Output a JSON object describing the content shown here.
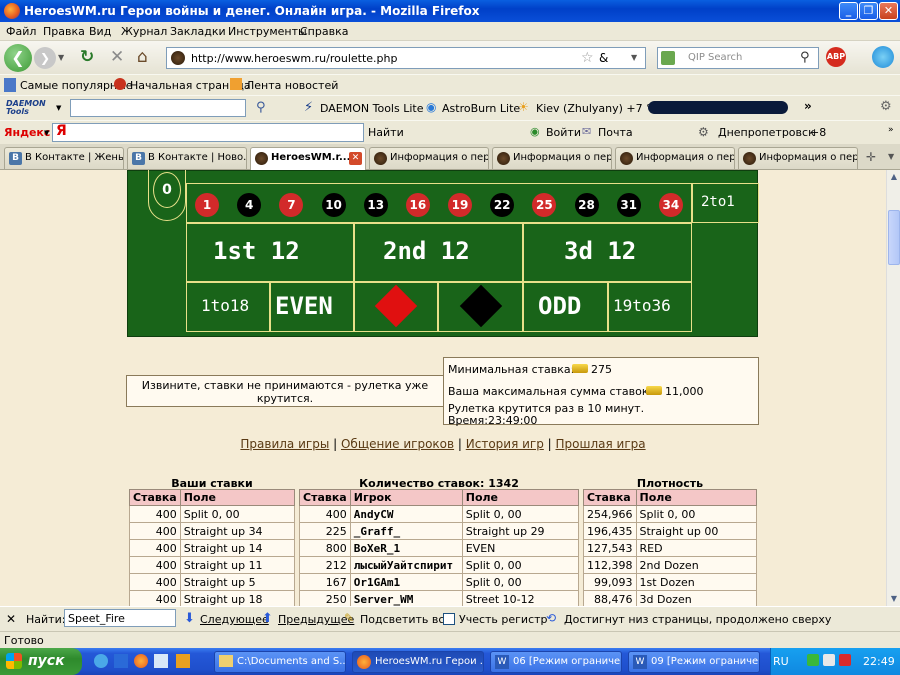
{
  "window": {
    "title": "HeroesWM.ru Герои войны и денег. Онлайн игра. - Mozilla Firefox"
  },
  "menu": [
    "Файл",
    "Правка",
    "Вид",
    "Журнал",
    "Закладки",
    "Инструменты",
    "Справка"
  ],
  "nav": {
    "url": "http://www.heroeswm.ru/roulette.php",
    "search_placeholder": "QIP Search"
  },
  "bookmarks": [
    "Самые популярные",
    "Начальная страница",
    "Лента новостей"
  ],
  "daemon_toolbar": {
    "logo": "DAEMON Tools",
    "items": [
      "DAEMON Tools Lite",
      "AstroBurn Lite",
      "Kiev (Zhulyany) +7 °C"
    ]
  },
  "yandex_toolbar": {
    "logo": "Яндекс",
    "items": [
      "Найти",
      "Войти",
      "Почта",
      "Днепропетровск",
      "+8"
    ]
  },
  "tabs": [
    {
      "label": "В Контакте | Жень..."
    },
    {
      "label": "В Контакте | Ново..."
    },
    {
      "label": "HeroesWM.r..."
    },
    {
      "label": "Информация о пер..."
    },
    {
      "label": "Информация о пер..."
    },
    {
      "label": "Информация о пер..."
    },
    {
      "label": "Информация о пер..."
    }
  ],
  "roulette": {
    "zero": "0",
    "numbers": [
      {
        "n": "1",
        "c": "red"
      },
      {
        "n": "4",
        "c": "black"
      },
      {
        "n": "7",
        "c": "red"
      },
      {
        "n": "10",
        "c": "black"
      },
      {
        "n": "13",
        "c": "black"
      },
      {
        "n": "16",
        "c": "red"
      },
      {
        "n": "19",
        "c": "red"
      },
      {
        "n": "22",
        "c": "black"
      },
      {
        "n": "25",
        "c": "red"
      },
      {
        "n": "28",
        "c": "black"
      },
      {
        "n": "31",
        "c": "black"
      },
      {
        "n": "34",
        "c": "red"
      }
    ],
    "column_bet": "2to1",
    "dozens": [
      "1st 12",
      "2nd 12",
      "3d 12"
    ],
    "outside": [
      "1to18",
      "EVEN",
      "ODD",
      "19to36"
    ]
  },
  "notice": "Извините, ставки не принимаются - рулетка уже крутится.",
  "info": {
    "min_bet_label": "Минимальная ставка:",
    "min_bet": "275",
    "max_bet_label": "Ваша максимальная сумма ставок:",
    "max_bet": "11,000",
    "spin_text": "Рулетка крутится раз в 10 минут.",
    "time_label": "Время:",
    "time": "23:49:00"
  },
  "links": [
    "Правила игры",
    "Общение игроков",
    "История игр",
    "Прошлая игра"
  ],
  "your_bets": {
    "title": "Ваши ставки",
    "headers": [
      "Ставка",
      "Поле"
    ],
    "rows": [
      [
        "400",
        "Split 0, 00"
      ],
      [
        "400",
        "Straight up 34"
      ],
      [
        "400",
        "Straight up 14"
      ],
      [
        "400",
        "Straight up 11"
      ],
      [
        "400",
        "Straight up 5"
      ],
      [
        "400",
        "Straight up 18"
      ]
    ]
  },
  "all_bets": {
    "title": "Количество ставок: 1342",
    "headers": [
      "Ставка",
      "Игрок",
      "Поле"
    ],
    "rows": [
      [
        "400",
        "AndyCW",
        "Split 0, 00"
      ],
      [
        "225",
        "_Graff_",
        "Straight up 29"
      ],
      [
        "800",
        "BoXeR_1",
        "EVEN"
      ],
      [
        "212",
        "лысыйУайтспирит",
        "Split 0, 00"
      ],
      [
        "167",
        "Or1GAm1",
        "Split 0, 00"
      ],
      [
        "250",
        "Server_WM",
        "Street 10-12"
      ]
    ]
  },
  "density": {
    "title": "Плотность",
    "headers": [
      "Ставка",
      "Поле"
    ],
    "rows": [
      [
        "254,966",
        "Split 0, 00"
      ],
      [
        "196,435",
        "Straight up 00"
      ],
      [
        "127,543",
        "RED"
      ],
      [
        "112,398",
        "2nd Dozen"
      ],
      [
        "99,093",
        "1st Dozen"
      ],
      [
        "88,476",
        "3d Dozen"
      ]
    ]
  },
  "findbar": {
    "label": "Найти:",
    "value": "Speet_Fire",
    "next": "Следующее",
    "prev": "Предыдущее",
    "highlight": "Подсветить все",
    "case": "Учесть регистр",
    "message": "Достигнут низ страницы, продолжено сверху"
  },
  "status": "Готово",
  "taskbar": {
    "start": "пуск",
    "tasks": [
      "C:\\Documents and S...",
      "HeroesWM.ru Герои ...",
      "06 [Режим ограниче...",
      "09 [Режим ограниче..."
    ],
    "lang": "RU",
    "clock": "22:49"
  }
}
